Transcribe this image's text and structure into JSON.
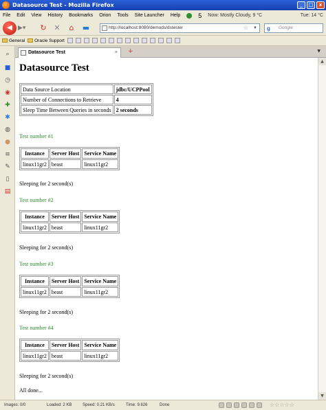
{
  "window": {
    "title": "Datasource Test - Mozilla Firefox",
    "min": "_",
    "max": "□",
    "close": "x"
  },
  "menu": {
    "items": [
      "File",
      "Edit",
      "View",
      "History",
      "Bookmarks",
      "Orion",
      "Tools",
      "Site Launcher",
      "Help"
    ],
    "count": "5",
    "weather": "Now: Mostly Cloudy, 9 °C",
    "forecast": "Tue: 14 °C"
  },
  "nav": {
    "url": "http://localhost:8080/demods/dstester",
    "search_placeholder": "Google"
  },
  "bookmarks": {
    "general": "General",
    "oracle": "Oracle Support"
  },
  "tab": {
    "title": "Datasource Test",
    "close": "×",
    "new": "+"
  },
  "page": {
    "title": "Datasource Test",
    "info": [
      {
        "label": "Data Source Location",
        "value": "jdbc/UCPPool"
      },
      {
        "label": "Number of Connections to Retrieve",
        "value": "4"
      },
      {
        "label": "Sleep Time Between Queries in seconds",
        "value": "2 seconds"
      }
    ],
    "headers": [
      "Instance",
      "Server Host",
      "Service Name"
    ],
    "tests": [
      {
        "heading": "Test number #1",
        "row": [
          "linux11gr2",
          "beast",
          "linux11gr2"
        ],
        "sleep": "Sleeping for 2 second(s)"
      },
      {
        "heading": "Test number #2",
        "row": [
          "linux11gr2",
          "beast",
          "linux11gr2"
        ],
        "sleep": "Sleeping for 2 second(s)"
      },
      {
        "heading": "Test number #3",
        "row": [
          "linux11gr2",
          "beast",
          "linux11gr2"
        ],
        "sleep": "Sleeping for 2 second(s)"
      },
      {
        "heading": "Test number #4",
        "row": [
          "linux11gr2",
          "beast",
          "linux11gr2"
        ],
        "sleep": "Sleeping for 2 second(s)"
      }
    ],
    "done": "All done..."
  },
  "status": {
    "images": "Images: 0/0",
    "loaded": "Loaded: 2 KB",
    "speed": "Speed: 0.21 KB/s",
    "time": "Time: 9.626",
    "done": "Done"
  }
}
